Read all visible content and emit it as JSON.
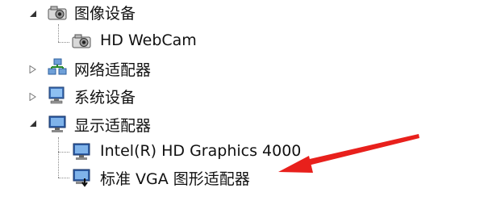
{
  "tree": {
    "categories": [
      {
        "label": "图像设备",
        "icon": "camera-icon",
        "expanded": true
      },
      {
        "label": "网络适配器",
        "icon": "network-icon",
        "expanded": false
      },
      {
        "label": "系统设备",
        "icon": "computer-icon",
        "expanded": false
      },
      {
        "label": "显示适配器",
        "icon": "display-icon",
        "expanded": true
      }
    ],
    "imaging_devices": [
      {
        "label": "HD WebCam",
        "icon": "camera-icon"
      }
    ],
    "display_adapters": [
      {
        "label": "Intel(R) HD Graphics 4000",
        "icon": "display-adapter-icon"
      },
      {
        "label": "标准 VGA 图形适配器",
        "icon": "display-adapter-warning-icon"
      }
    ]
  },
  "annotation": {
    "color": "#e8201c",
    "icon": "red-arrow-icon"
  }
}
